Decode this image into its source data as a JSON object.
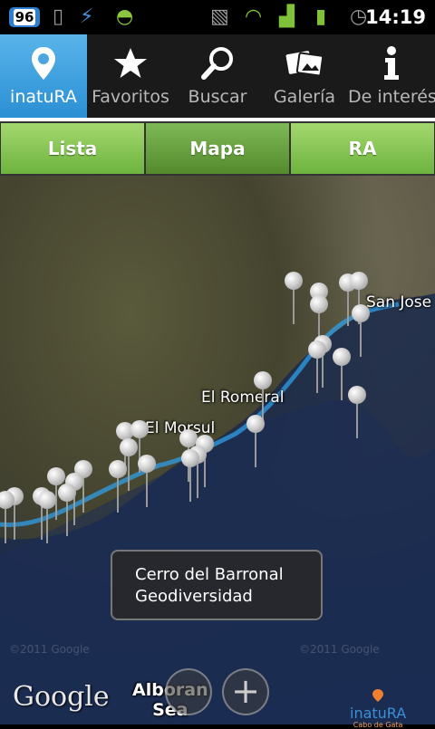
{
  "status_bar": {
    "badge": "96",
    "time": "14:19",
    "icons": [
      "notification-badge-icon",
      "phone-icon",
      "usb-icon",
      "android-icon",
      "vibrate-icon",
      "wifi-icon",
      "signal-icon",
      "battery-icon",
      "alarm-icon"
    ]
  },
  "tabs": [
    {
      "label": "inatuRA",
      "icon": "pin-icon",
      "active": true
    },
    {
      "label": "Favoritos",
      "icon": "star-icon",
      "active": false
    },
    {
      "label": "Buscar",
      "icon": "search-icon",
      "active": false
    },
    {
      "label": "Galería",
      "icon": "gallery-icon",
      "active": false
    },
    {
      "label": "De interés",
      "icon": "info-icon",
      "active": false
    }
  ],
  "view_switch": {
    "items": [
      "Lista",
      "Mapa",
      "RA"
    ],
    "selected": "Mapa"
  },
  "map": {
    "places": [
      "San Jose",
      "El Romeral",
      "El Morsul"
    ],
    "popup": {
      "line1": "Cerro del Barronal",
      "line2": "Geodiversidad"
    },
    "copyright": "©2011 Google",
    "sea_label": [
      "Alboran",
      "Sea"
    ],
    "provider": "Google",
    "zoom_in": "+",
    "brand": {
      "name": "inatuRA",
      "sub": "Cabo de Gata"
    }
  }
}
